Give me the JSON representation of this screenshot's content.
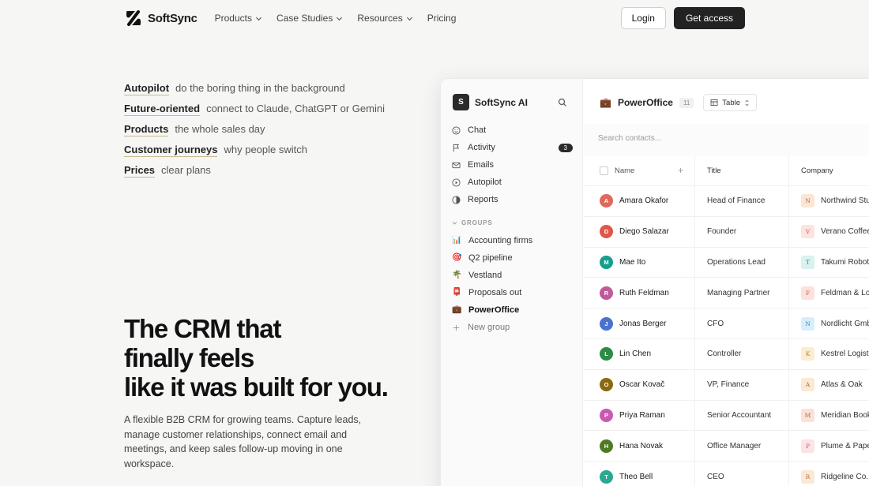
{
  "nav": {
    "brand": "SoftSync",
    "links": [
      {
        "label": "Products",
        "dropdown": true
      },
      {
        "label": "Case Studies",
        "dropdown": true
      },
      {
        "label": "Resources",
        "dropdown": true
      },
      {
        "label": "Pricing",
        "dropdown": false
      }
    ],
    "login": "Login",
    "get_access": "Get access"
  },
  "features": [
    {
      "key": "Autopilot",
      "desc": "do the boring thing in the background"
    },
    {
      "key": "Future-oriented",
      "desc": "connect to Claude, ChatGPT or Gemini"
    },
    {
      "key": "Products",
      "desc": "the whole sales day"
    },
    {
      "key": "Customer journeys",
      "desc": "why people switch"
    },
    {
      "key": "Prices",
      "desc": "clear plans"
    }
  ],
  "hero": {
    "title_line1": "The CRM that",
    "title_line2": "finally feels",
    "title_line3": "like it was built for you.",
    "description": "A flexible B2B CRM for growing teams. Capture leads, manage customer relationships, connect email and meetings, and keep sales follow-up moving in one workspace."
  },
  "app": {
    "sidebar": {
      "logo_letter": "S",
      "title": "SoftSync AI",
      "items": [
        {
          "label": "Chat",
          "icon": "smile-icon"
        },
        {
          "label": "Activity",
          "icon": "flag-icon",
          "badge": "3"
        },
        {
          "label": "Emails",
          "icon": "mail-icon"
        },
        {
          "label": "Autopilot",
          "icon": "play-circle-icon"
        },
        {
          "label": "Reports",
          "icon": "pie-icon"
        }
      ],
      "groups_label": "GROUPS",
      "groups": [
        {
          "label": "Accounting firms",
          "emoji": "📊"
        },
        {
          "label": "Q2 pipeline",
          "emoji": "🎯"
        },
        {
          "label": "Vestland",
          "emoji": "🌴"
        },
        {
          "label": "Proposals out",
          "emoji": "📮"
        },
        {
          "label": "PowerOffice",
          "emoji": "💼"
        }
      ],
      "new_group": "New group"
    },
    "main": {
      "icon": "💼",
      "title": "PowerOffice",
      "count": "11",
      "view": "Table",
      "search_placeholder": "Search contacts...",
      "columns": {
        "name": "Name",
        "title": "Title",
        "company": "Company"
      },
      "rows": [
        {
          "initial": "A",
          "name": "Amara Okafor",
          "title": "Head of Finance",
          "co_initial": "N",
          "company": "Northwind Stu",
          "avatar_color": "#e0695a",
          "co_bg": "#fbe6d6",
          "co_fg": "#b0684a"
        },
        {
          "initial": "D",
          "name": "Diego Salazar",
          "title": "Founder",
          "co_initial": "V",
          "company": "Verano Coffee",
          "avatar_color": "#e0574a",
          "co_bg": "#fde4e0",
          "co_fg": "#c25a4c"
        },
        {
          "initial": "M",
          "name": "Mae Ito",
          "title": "Operations Lead",
          "co_initial": "T",
          "company": "Takumi Roboti",
          "avatar_color": "#14a08c",
          "co_bg": "#d9f1ef",
          "co_fg": "#2b8f86"
        },
        {
          "initial": "R",
          "name": "Ruth Feldman",
          "title": "Managing Partner",
          "co_initial": "F",
          "company": "Feldman & Lov",
          "avatar_color": "#c05a9a",
          "co_bg": "#fbe2dc",
          "co_fg": "#c0614f"
        },
        {
          "initial": "J",
          "name": "Jonas Berger",
          "title": "CFO",
          "co_initial": "N",
          "company": "Nordlicht Gmb",
          "avatar_color": "#4a72d0",
          "co_bg": "#d8eefa",
          "co_fg": "#3d86b8"
        },
        {
          "initial": "L",
          "name": "Lin Chen",
          "title": "Controller",
          "co_initial": "K",
          "company": "Kestrel Logisti",
          "avatar_color": "#2e8a44",
          "co_bg": "#fbedd2",
          "co_fg": "#b0803a"
        },
        {
          "initial": "O",
          "name": "Oscar Kovač",
          "title": "VP, Finance",
          "co_initial": "A",
          "company": "Atlas & Oak",
          "avatar_color": "#8a6a10",
          "co_bg": "#fbe9d4",
          "co_fg": "#a8713e"
        },
        {
          "initial": "P",
          "name": "Priya Raman",
          "title": "Senior Accountant",
          "co_initial": "M",
          "company": "Meridian Book",
          "avatar_color": "#c95ab0",
          "co_bg": "#fbe2d8",
          "co_fg": "#b0664e"
        },
        {
          "initial": "H",
          "name": "Hana Novak",
          "title": "Office Manager",
          "co_initial": "P",
          "company": "Plume & Pape",
          "avatar_color": "#4f7a24",
          "co_bg": "#fbe3e6",
          "co_fg": "#c0606a"
        },
        {
          "initial": "T",
          "name": "Theo Bell",
          "title": "CEO",
          "co_initial": "R",
          "company": "Ridgeline Co.",
          "avatar_color": "#2aa890",
          "co_bg": "#fbe8d6",
          "co_fg": "#b0703e"
        }
      ]
    }
  }
}
